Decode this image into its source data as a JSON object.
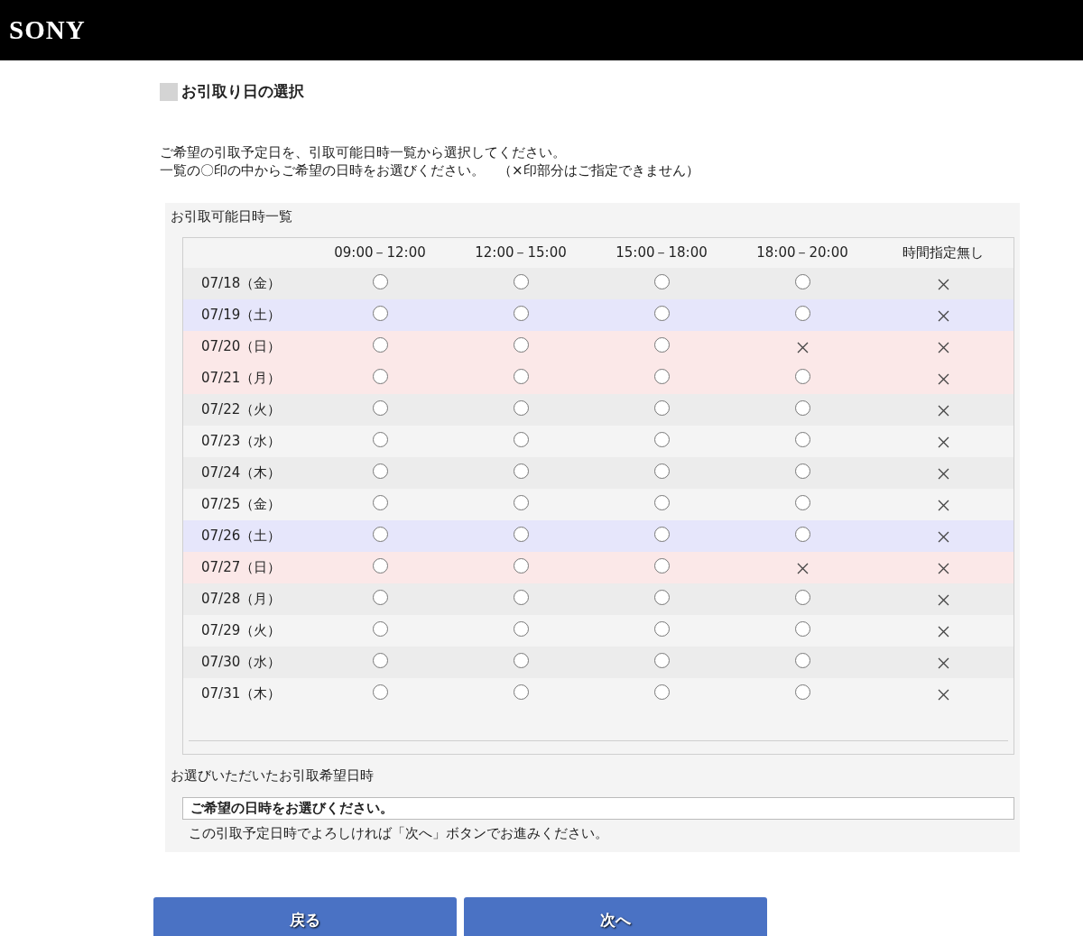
{
  "header": {
    "logo": "SONY"
  },
  "heading": "お引取り日の選択",
  "intro": [
    "ご希望の引取予定日を、引取可能日時一覧から選択してください。",
    "一覧の〇印の中からご希望の日時をお選びください。　（×印部分はご指定できません）"
  ],
  "panel": {
    "title": "お引取可能日時一覧",
    "table": {
      "columns": [
        "09:00－12:00",
        "12:00－15:00",
        "15:00－18:00",
        "18:00－20:00",
        "時間指定無し"
      ],
      "rows": [
        {
          "date": "07/18（金）",
          "kind": "weekday",
          "slots": [
            true,
            true,
            true,
            true,
            false
          ]
        },
        {
          "date": "07/19（土）",
          "kind": "saturday",
          "slots": [
            true,
            true,
            true,
            true,
            false
          ]
        },
        {
          "date": "07/20（日）",
          "kind": "holiday",
          "slots": [
            true,
            true,
            true,
            false,
            false
          ]
        },
        {
          "date": "07/21（月）",
          "kind": "holiday",
          "slots": [
            true,
            true,
            true,
            true,
            false
          ]
        },
        {
          "date": "07/22（火）",
          "kind": "weekday",
          "slots": [
            true,
            true,
            true,
            true,
            false
          ]
        },
        {
          "date": "07/23（水）",
          "kind": "weekday",
          "slots": [
            true,
            true,
            true,
            true,
            false
          ]
        },
        {
          "date": "07/24（木）",
          "kind": "weekday",
          "slots": [
            true,
            true,
            true,
            true,
            false
          ]
        },
        {
          "date": "07/25（金）",
          "kind": "weekday",
          "slots": [
            true,
            true,
            true,
            true,
            false
          ]
        },
        {
          "date": "07/26（土）",
          "kind": "saturday",
          "slots": [
            true,
            true,
            true,
            true,
            false
          ]
        },
        {
          "date": "07/27（日）",
          "kind": "holiday",
          "slots": [
            true,
            true,
            true,
            false,
            false
          ]
        },
        {
          "date": "07/28（月）",
          "kind": "weekday",
          "slots": [
            true,
            true,
            true,
            true,
            false
          ]
        },
        {
          "date": "07/29（火）",
          "kind": "weekday",
          "slots": [
            true,
            true,
            true,
            true,
            false
          ]
        },
        {
          "date": "07/30（水）",
          "kind": "weekday",
          "slots": [
            true,
            true,
            true,
            true,
            false
          ]
        },
        {
          "date": "07/31（木）",
          "kind": "weekday",
          "slots": [
            true,
            true,
            true,
            true,
            false
          ]
        }
      ]
    },
    "selection_label": "お選びいただいたお引取希望日時",
    "selection_value": "ご希望の日時をお選びください。",
    "note": "この引取予定日時でよろしければ「次へ」ボタンでお進みください。"
  },
  "buttons": [
    "戻る",
    "次へ"
  ]
}
